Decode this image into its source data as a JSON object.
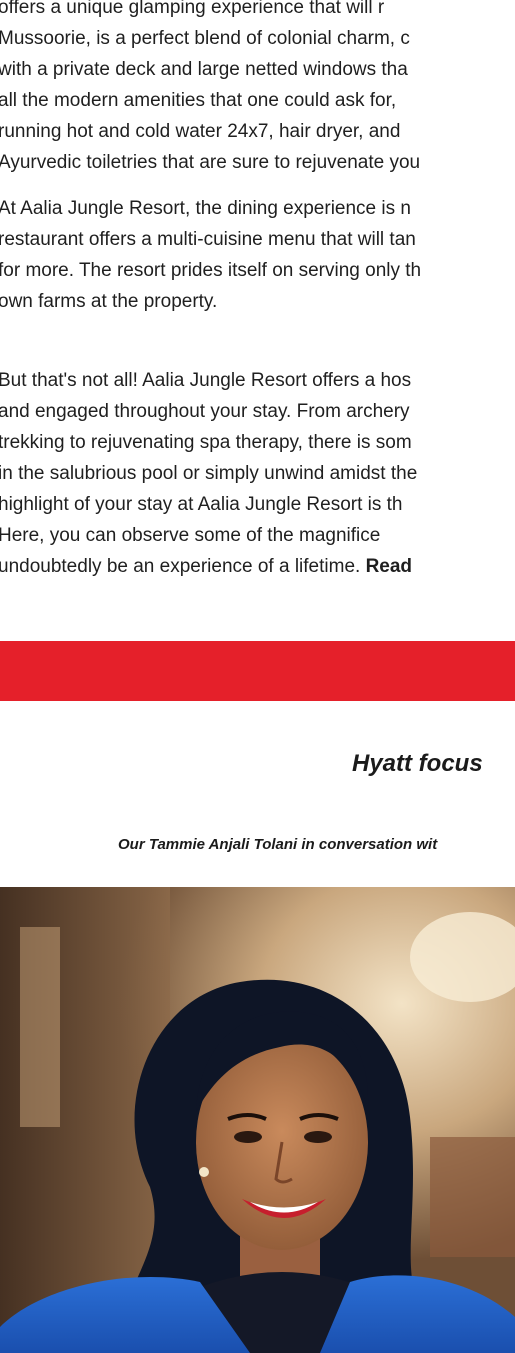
{
  "article": {
    "paragraph1": [
      "offers a unique glamping experience that will r",
      "Mussoorie, is a perfect blend of colonial charm, c",
      "with a private deck and large netted windows tha",
      "all the modern amenities that one could ask for,",
      "running hot and cold water 24x7, hair dryer, and",
      "Ayurvedic toiletries that are sure to rejuvenate you"
    ],
    "paragraph2": [
      "At Aalia Jungle Resort, the dining experience is n",
      "restaurant offers a multi-cuisine menu that will tan",
      "for more. The resort prides itself on serving only th",
      "own farms at the property."
    ],
    "paragraph3": [
      "But that's not all! Aalia Jungle Resort offers a hos",
      "and engaged throughout your stay. From archery",
      "trekking to rejuvenating spa therapy, there is som",
      "in the salubrious pool or simply unwind amidst the",
      "highlight of your stay at Aalia Jungle Resort is th",
      "Here, you can observe some of the magnifice"
    ],
    "paragraph3_last_text": "undoubtedly be an experience of a lifetime. ",
    "read_more_label": "Read"
  },
  "feature": {
    "title": "Hyatt focus",
    "subtitle": "Our Tammie Anjali Tolani in conversation wit"
  },
  "colors": {
    "accent_band": "#e5202a"
  }
}
